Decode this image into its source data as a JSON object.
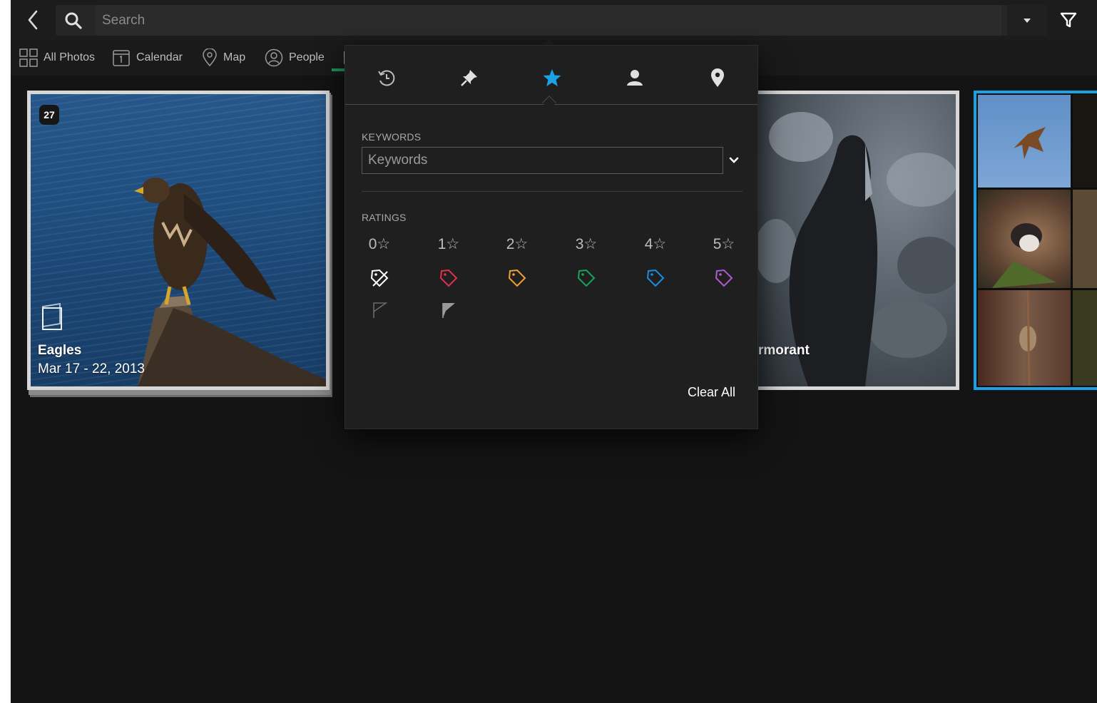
{
  "search": {
    "placeholder": "Search"
  },
  "nav": {
    "items": [
      {
        "label": "All Photos",
        "icon": "grid-icon"
      },
      {
        "label": "Calendar",
        "icon": "calendar-icon"
      },
      {
        "label": "Map",
        "icon": "map-pin-icon"
      },
      {
        "label": "People",
        "icon": "person-icon"
      }
    ]
  },
  "cards": [
    {
      "title": "Eagles",
      "date": "Mar 17 - 22, 2013",
      "count": "27"
    },
    {
      "title": "rmorant"
    }
  ],
  "filter_popover": {
    "tabs": [
      {
        "name": "recent",
        "icon": "history-icon"
      },
      {
        "name": "pinned",
        "icon": "pin-icon"
      },
      {
        "name": "ratings",
        "icon": "star-icon",
        "active": true
      },
      {
        "name": "people",
        "icon": "person-icon"
      },
      {
        "name": "places",
        "icon": "location-icon"
      }
    ],
    "keywords_label": "KEYWORDS",
    "keywords_placeholder": "Keywords",
    "ratings_label": "RATINGS",
    "ratings": [
      "0☆",
      "1☆",
      "2☆",
      "3☆",
      "4☆",
      "5☆"
    ],
    "tag_colors": [
      "#ffffff",
      "#e5304b",
      "#f0a132",
      "#16a35a",
      "#1a8ee0",
      "#b05ad0"
    ],
    "clear_all": "Clear All"
  },
  "colors": {
    "accent": "#1aa1e6",
    "active_star": "#1aa1e6",
    "nav_underline": "#1f9b5e"
  }
}
